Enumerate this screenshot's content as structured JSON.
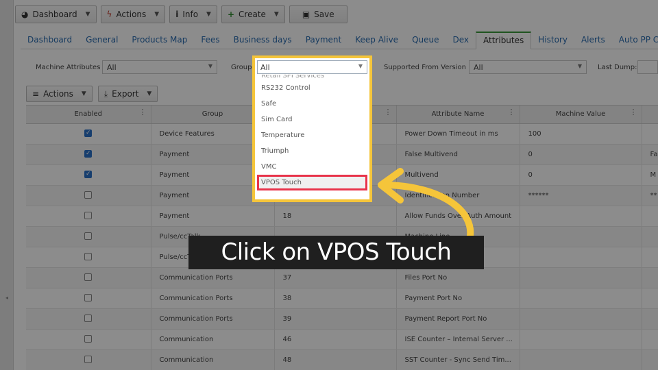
{
  "toolbar": {
    "dashboard": "Dashboard",
    "actions": "Actions",
    "info": "Info",
    "create": "Create",
    "save": "Save"
  },
  "tabs": [
    "Dashboard",
    "General",
    "Products Map",
    "Fees",
    "Business days",
    "Payment",
    "Keep Alive",
    "Queue",
    "Dex",
    "Attributes",
    "History",
    "Alerts",
    "Auto PP Cards"
  ],
  "filters": {
    "machine_attributes_label": "Machine Attributes",
    "machine_attributes_value": "All",
    "group_label": "Group",
    "supported_label": "Supported From Version",
    "supported_value": "All",
    "last_dump_label": "Last Dump:"
  },
  "grid_actions": {
    "actions": "Actions",
    "export": "Export"
  },
  "columns": {
    "enabled": "Enabled",
    "group": "Group",
    "attribute_name": "Attribute Name",
    "machine_value": "Machine Value"
  },
  "rows": [
    {
      "enabled": true,
      "group": "Device Features",
      "id": "",
      "name": "Power Down Timeout in ms",
      "value": "100",
      "extra": ""
    },
    {
      "enabled": true,
      "group": "Payment",
      "id": "",
      "name": "False Multivend",
      "value": "0",
      "extra": "Fa"
    },
    {
      "enabled": true,
      "group": "Payment",
      "id": "",
      "name": "Multivend",
      "value": "0",
      "extra": "M"
    },
    {
      "enabled": false,
      "group": "Payment",
      "id": "",
      "name": "Identification Number",
      "value": "******",
      "extra": "**"
    },
    {
      "enabled": false,
      "group": "Payment",
      "id": "18",
      "name": "Allow Funds Over Auth Amount",
      "value": "",
      "extra": ""
    },
    {
      "enabled": false,
      "group": "Pulse/ccTalk",
      "id": "",
      "name": "Machine Line",
      "value": "",
      "extra": ""
    },
    {
      "enabled": false,
      "group": "Pulse/ccTalk",
      "id": "",
      "name": "",
      "value": "",
      "extra": ""
    },
    {
      "enabled": false,
      "group": "Communication Ports",
      "id": "37",
      "name": "Files Port No",
      "value": "",
      "extra": ""
    },
    {
      "enabled": false,
      "group": "Communication Ports",
      "id": "38",
      "name": "Payment Port No",
      "value": "",
      "extra": ""
    },
    {
      "enabled": false,
      "group": "Communication Ports",
      "id": "39",
      "name": "Payment Report Port No",
      "value": "",
      "extra": ""
    },
    {
      "enabled": false,
      "group": "Communication",
      "id": "46",
      "name": "ISE Counter – Internal Server ...",
      "value": "",
      "extra": ""
    },
    {
      "enabled": false,
      "group": "Communication",
      "id": "48",
      "name": "SST Counter - Sync Send Tim...",
      "value": "",
      "extra": ""
    }
  ],
  "group_dropdown": {
    "value": "All",
    "partial_item": "Retail SPI Services",
    "items": [
      "RS232 Control",
      "Safe",
      "Sim Card",
      "Temperature",
      "Triumph",
      "VMC"
    ],
    "highlighted_item": "VPOS Touch"
  },
  "instruction": "Click on VPOS Touch",
  "colors": {
    "highlight_frame": "#f5c53a",
    "target_outline": "#e8334a",
    "arrow": "#f5c53a",
    "callout_bg": "#1f1f1f"
  }
}
